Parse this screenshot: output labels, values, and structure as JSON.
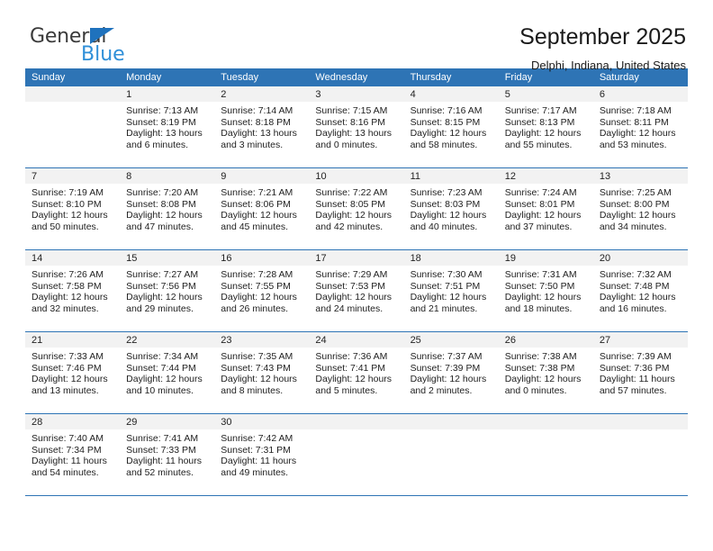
{
  "brand": {
    "name_top": "General",
    "name_bottom": "Blue",
    "triangle_icon": "triangle-icon",
    "accent_color": "#2f8fd8"
  },
  "header": {
    "title": "September 2025",
    "subtitle": "Delphi, Indiana, United States"
  },
  "theme": {
    "header_bg": "#2e74b5",
    "daynum_bg": "#f2f2f2",
    "grid_line": "#2e74b5",
    "text": "#222222"
  },
  "calendar": {
    "weekday_headers": [
      "Sunday",
      "Monday",
      "Tuesday",
      "Wednesday",
      "Thursday",
      "Friday",
      "Saturday"
    ],
    "labels": {
      "sunrise": "Sunrise:",
      "sunset": "Sunset:",
      "daylight": "Daylight:"
    },
    "weeks": [
      [
        {
          "day": "",
          "sunrise": "",
          "sunset": "",
          "daylight_line1": "",
          "daylight_line2": "",
          "blank": true
        },
        {
          "day": "1",
          "sunrise": "Sunrise: 7:13 AM",
          "sunset": "Sunset: 8:19 PM",
          "daylight_line1": "Daylight: 13 hours",
          "daylight_line2": "and 6 minutes."
        },
        {
          "day": "2",
          "sunrise": "Sunrise: 7:14 AM",
          "sunset": "Sunset: 8:18 PM",
          "daylight_line1": "Daylight: 13 hours",
          "daylight_line2": "and 3 minutes."
        },
        {
          "day": "3",
          "sunrise": "Sunrise: 7:15 AM",
          "sunset": "Sunset: 8:16 PM",
          "daylight_line1": "Daylight: 13 hours",
          "daylight_line2": "and 0 minutes."
        },
        {
          "day": "4",
          "sunrise": "Sunrise: 7:16 AM",
          "sunset": "Sunset: 8:15 PM",
          "daylight_line1": "Daylight: 12 hours",
          "daylight_line2": "and 58 minutes."
        },
        {
          "day": "5",
          "sunrise": "Sunrise: 7:17 AM",
          "sunset": "Sunset: 8:13 PM",
          "daylight_line1": "Daylight: 12 hours",
          "daylight_line2": "and 55 minutes."
        },
        {
          "day": "6",
          "sunrise": "Sunrise: 7:18 AM",
          "sunset": "Sunset: 8:11 PM",
          "daylight_line1": "Daylight: 12 hours",
          "daylight_line2": "and 53 minutes."
        }
      ],
      [
        {
          "day": "7",
          "sunrise": "Sunrise: 7:19 AM",
          "sunset": "Sunset: 8:10 PM",
          "daylight_line1": "Daylight: 12 hours",
          "daylight_line2": "and 50 minutes."
        },
        {
          "day": "8",
          "sunrise": "Sunrise: 7:20 AM",
          "sunset": "Sunset: 8:08 PM",
          "daylight_line1": "Daylight: 12 hours",
          "daylight_line2": "and 47 minutes."
        },
        {
          "day": "9",
          "sunrise": "Sunrise: 7:21 AM",
          "sunset": "Sunset: 8:06 PM",
          "daylight_line1": "Daylight: 12 hours",
          "daylight_line2": "and 45 minutes."
        },
        {
          "day": "10",
          "sunrise": "Sunrise: 7:22 AM",
          "sunset": "Sunset: 8:05 PM",
          "daylight_line1": "Daylight: 12 hours",
          "daylight_line2": "and 42 minutes."
        },
        {
          "day": "11",
          "sunrise": "Sunrise: 7:23 AM",
          "sunset": "Sunset: 8:03 PM",
          "daylight_line1": "Daylight: 12 hours",
          "daylight_line2": "and 40 minutes."
        },
        {
          "day": "12",
          "sunrise": "Sunrise: 7:24 AM",
          "sunset": "Sunset: 8:01 PM",
          "daylight_line1": "Daylight: 12 hours",
          "daylight_line2": "and 37 minutes."
        },
        {
          "day": "13",
          "sunrise": "Sunrise: 7:25 AM",
          "sunset": "Sunset: 8:00 PM",
          "daylight_line1": "Daylight: 12 hours",
          "daylight_line2": "and 34 minutes."
        }
      ],
      [
        {
          "day": "14",
          "sunrise": "Sunrise: 7:26 AM",
          "sunset": "Sunset: 7:58 PM",
          "daylight_line1": "Daylight: 12 hours",
          "daylight_line2": "and 32 minutes."
        },
        {
          "day": "15",
          "sunrise": "Sunrise: 7:27 AM",
          "sunset": "Sunset: 7:56 PM",
          "daylight_line1": "Daylight: 12 hours",
          "daylight_line2": "and 29 minutes."
        },
        {
          "day": "16",
          "sunrise": "Sunrise: 7:28 AM",
          "sunset": "Sunset: 7:55 PM",
          "daylight_line1": "Daylight: 12 hours",
          "daylight_line2": "and 26 minutes."
        },
        {
          "day": "17",
          "sunrise": "Sunrise: 7:29 AM",
          "sunset": "Sunset: 7:53 PM",
          "daylight_line1": "Daylight: 12 hours",
          "daylight_line2": "and 24 minutes."
        },
        {
          "day": "18",
          "sunrise": "Sunrise: 7:30 AM",
          "sunset": "Sunset: 7:51 PM",
          "daylight_line1": "Daylight: 12 hours",
          "daylight_line2": "and 21 minutes."
        },
        {
          "day": "19",
          "sunrise": "Sunrise: 7:31 AM",
          "sunset": "Sunset: 7:50 PM",
          "daylight_line1": "Daylight: 12 hours",
          "daylight_line2": "and 18 minutes."
        },
        {
          "day": "20",
          "sunrise": "Sunrise: 7:32 AM",
          "sunset": "Sunset: 7:48 PM",
          "daylight_line1": "Daylight: 12 hours",
          "daylight_line2": "and 16 minutes."
        }
      ],
      [
        {
          "day": "21",
          "sunrise": "Sunrise: 7:33 AM",
          "sunset": "Sunset: 7:46 PM",
          "daylight_line1": "Daylight: 12 hours",
          "daylight_line2": "and 13 minutes."
        },
        {
          "day": "22",
          "sunrise": "Sunrise: 7:34 AM",
          "sunset": "Sunset: 7:44 PM",
          "daylight_line1": "Daylight: 12 hours",
          "daylight_line2": "and 10 minutes."
        },
        {
          "day": "23",
          "sunrise": "Sunrise: 7:35 AM",
          "sunset": "Sunset: 7:43 PM",
          "daylight_line1": "Daylight: 12 hours",
          "daylight_line2": "and 8 minutes."
        },
        {
          "day": "24",
          "sunrise": "Sunrise: 7:36 AM",
          "sunset": "Sunset: 7:41 PM",
          "daylight_line1": "Daylight: 12 hours",
          "daylight_line2": "and 5 minutes."
        },
        {
          "day": "25",
          "sunrise": "Sunrise: 7:37 AM",
          "sunset": "Sunset: 7:39 PM",
          "daylight_line1": "Daylight: 12 hours",
          "daylight_line2": "and 2 minutes."
        },
        {
          "day": "26",
          "sunrise": "Sunrise: 7:38 AM",
          "sunset": "Sunset: 7:38 PM",
          "daylight_line1": "Daylight: 12 hours",
          "daylight_line2": "and 0 minutes."
        },
        {
          "day": "27",
          "sunrise": "Sunrise: 7:39 AM",
          "sunset": "Sunset: 7:36 PM",
          "daylight_line1": "Daylight: 11 hours",
          "daylight_line2": "and 57 minutes."
        }
      ],
      [
        {
          "day": "28",
          "sunrise": "Sunrise: 7:40 AM",
          "sunset": "Sunset: 7:34 PM",
          "daylight_line1": "Daylight: 11 hours",
          "daylight_line2": "and 54 minutes."
        },
        {
          "day": "29",
          "sunrise": "Sunrise: 7:41 AM",
          "sunset": "Sunset: 7:33 PM",
          "daylight_line1": "Daylight: 11 hours",
          "daylight_line2": "and 52 minutes."
        },
        {
          "day": "30",
          "sunrise": "Sunrise: 7:42 AM",
          "sunset": "Sunset: 7:31 PM",
          "daylight_line1": "Daylight: 11 hours",
          "daylight_line2": "and 49 minutes."
        },
        {
          "day": "",
          "sunrise": "",
          "sunset": "",
          "daylight_line1": "",
          "daylight_line2": "",
          "blank": true
        },
        {
          "day": "",
          "sunrise": "",
          "sunset": "",
          "daylight_line1": "",
          "daylight_line2": "",
          "blank": true
        },
        {
          "day": "",
          "sunrise": "",
          "sunset": "",
          "daylight_line1": "",
          "daylight_line2": "",
          "blank": true
        },
        {
          "day": "",
          "sunrise": "",
          "sunset": "",
          "daylight_line1": "",
          "daylight_line2": "",
          "blank": true
        }
      ]
    ]
  }
}
